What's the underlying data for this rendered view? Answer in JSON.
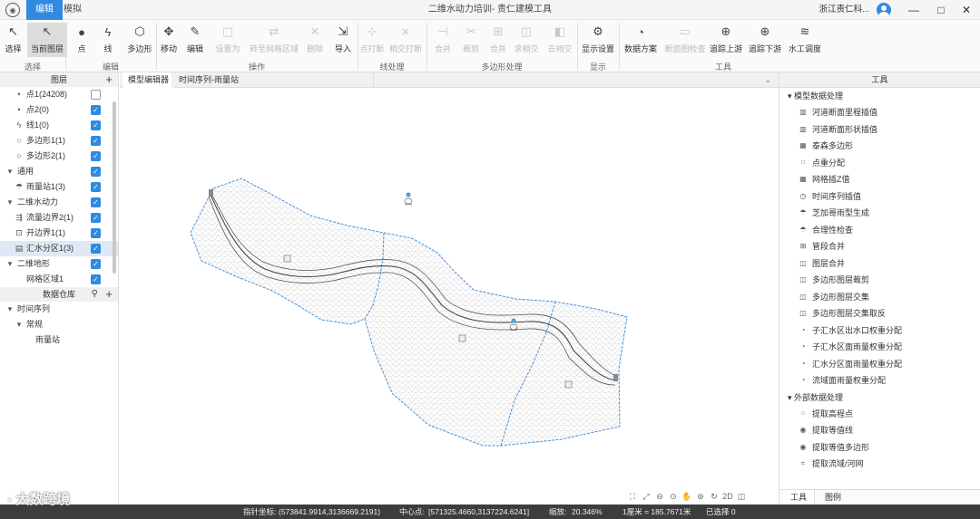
{
  "titlebar": {
    "menu_tabs": [
      "编辑",
      "模拟"
    ],
    "title": "二维水动力培训- 责仁建模工具",
    "user": "浙江责仁科...",
    "controls": [
      "—",
      "□",
      "✕"
    ]
  },
  "toolbar": {
    "buttons": [
      {
        "label": "选择",
        "icon": "↖",
        "enabled": true
      },
      {
        "label": "当前图层",
        "icon": "↖",
        "enabled": true,
        "active": true
      },
      {
        "label": "点",
        "icon": "●",
        "enabled": true
      },
      {
        "label": "线",
        "icon": "ϟ",
        "enabled": true
      },
      {
        "label": "多边形",
        "icon": "⬡",
        "enabled": true
      },
      {
        "label": "移动",
        "icon": "✥",
        "enabled": true
      },
      {
        "label": "编辑",
        "icon": "✎",
        "enabled": true
      },
      {
        "label": "设置为",
        "icon": "▢",
        "enabled": false
      },
      {
        "label": "转至网格区域",
        "icon": "⇄",
        "enabled": false
      },
      {
        "label": "删除",
        "icon": "✕",
        "enabled": false
      },
      {
        "label": "导入",
        "icon": "⇲",
        "enabled": true
      },
      {
        "label": "点打断",
        "icon": "⊹",
        "enabled": false
      },
      {
        "label": "相交打断",
        "icon": "⨯",
        "enabled": false
      },
      {
        "label": "合并",
        "icon": "⊣",
        "enabled": false
      },
      {
        "label": "裁剪",
        "icon": "✂",
        "enabled": false
      },
      {
        "label": "合并",
        "icon": "⊞",
        "enabled": false
      },
      {
        "label": "求相交",
        "icon": "◫",
        "enabled": false
      },
      {
        "label": "去相交",
        "icon": "◧",
        "enabled": false
      },
      {
        "label": "显示设置",
        "icon": "⚙",
        "enabled": true
      },
      {
        "label": "数据方案",
        "icon": "◔",
        "enabled": true
      },
      {
        "label": "断面图检查",
        "icon": "▭",
        "enabled": false
      },
      {
        "label": "追踪上游",
        "icon": "⊕",
        "enabled": true
      },
      {
        "label": "追踪下游",
        "icon": "⊕",
        "enabled": true
      },
      {
        "label": "水工调度",
        "icon": "≋",
        "enabled": true
      }
    ],
    "groups": [
      "选择",
      "编辑",
      "操作",
      "线处理",
      "多边形处理",
      "显示",
      "工具"
    ]
  },
  "layers_panel": {
    "title": "图层",
    "rows": [
      {
        "label": "点1(24208)",
        "icon": "•",
        "indent": 1,
        "checked": false
      },
      {
        "label": "点2(0)",
        "icon": "•",
        "indent": 1,
        "checked": true
      },
      {
        "label": "线1(0)",
        "icon": "ϟ",
        "indent": 1,
        "checked": true
      },
      {
        "label": "多边形1(1)",
        "icon": "○",
        "indent": 1,
        "checked": true
      },
      {
        "label": "多边形2(1)",
        "icon": "○",
        "indent": 1,
        "checked": true
      },
      {
        "label": "通用",
        "icon": "▾",
        "indent": 0,
        "checked": true
      },
      {
        "label": "雨量站1(3)",
        "icon": "☂",
        "indent": 1,
        "checked": true
      },
      {
        "label": "二维水动力",
        "icon": "▾",
        "indent": 0,
        "checked": true
      },
      {
        "label": "流量边界2(1)",
        "icon": "⇶",
        "indent": 1,
        "checked": true
      },
      {
        "label": "开边界1(1)",
        "icon": "⊡",
        "indent": 1,
        "checked": true
      },
      {
        "label": "汇水分区1(3)",
        "icon": "▤",
        "indent": 1,
        "checked": true,
        "selected": true
      },
      {
        "label": "二维地形",
        "icon": "▾",
        "indent": 0,
        "checked": true
      },
      {
        "label": "网格区域1",
        "icon": "",
        "indent": 1,
        "checked": true
      }
    ]
  },
  "warehouse": {
    "title": "数据仓库",
    "rows": [
      {
        "label": "时间序列",
        "icon": "▾",
        "indent": 0
      },
      {
        "label": "常规",
        "icon": "▾",
        "indent": 1
      },
      {
        "label": "雨量站",
        "icon": "",
        "indent": 2
      }
    ]
  },
  "doc_tabs": [
    "模型编辑器",
    "时间序列-雨量站"
  ],
  "doc_dropdown": "⌄",
  "map_tools": [
    "⛶",
    "⤢",
    "⊖",
    "⊙",
    "✋",
    "⊚",
    "↻",
    "2D",
    "◫"
  ],
  "tools_panel": {
    "title": "工具",
    "sections": [
      {
        "title": "模型数据处理",
        "items": [
          {
            "label": "河道断面里程插值",
            "icon": "▥"
          },
          {
            "label": "河道断面形状插值",
            "icon": "▥"
          },
          {
            "label": "泰森多边形",
            "icon": "▦"
          },
          {
            "label": "点重分配",
            "icon": "⁙"
          },
          {
            "label": "网格插Z值",
            "icon": "▦"
          },
          {
            "label": "时间序列插值",
            "icon": "◷"
          },
          {
            "label": "芝加哥雨型生成",
            "icon": "☂"
          },
          {
            "label": "合理性检查",
            "icon": "☂"
          },
          {
            "label": "管段合并",
            "icon": "⊞"
          },
          {
            "label": "图层合并",
            "icon": "◫"
          },
          {
            "label": "多边形图层裁剪",
            "icon": "◫"
          },
          {
            "label": "多边形图层交集",
            "icon": "◫"
          },
          {
            "label": "多边形图层交集取反",
            "icon": "◫"
          },
          {
            "label": "子汇水区出水口权重分配",
            "icon": "◔"
          },
          {
            "label": "子汇水区面雨量权重分配",
            "icon": "◔"
          },
          {
            "label": "汇水分区面雨量权重分配",
            "icon": "◔"
          },
          {
            "label": "流域面雨量权重分配",
            "icon": "◔"
          }
        ]
      },
      {
        "title": "外部数据处理",
        "items": [
          {
            "label": "提取高程点",
            "icon": "⁘"
          },
          {
            "label": "提取等值线",
            "icon": "◉"
          },
          {
            "label": "提取等值多边形",
            "icon": "◉"
          },
          {
            "label": "提取流域/河网",
            "icon": "≈"
          }
        ]
      }
    ],
    "tabs": [
      "工具",
      "图例"
    ]
  },
  "status": {
    "pointer_label": "指针坐标:",
    "pointer_value": "(573841.9914,3136669.2191)",
    "center_label": "中心点:",
    "center_value": "[571325.4660,3137224.6241]",
    "zoom_label": "缩放:",
    "zoom_value": "20.346%",
    "scale_text": "1厘米 = 185.7671米",
    "selected_text": "已选择 0"
  },
  "watermark": "大数跨境",
  "colors": {
    "accent": "#2f8ae0",
    "boundary": "#4a90d9",
    "river": "#444444",
    "mesh": "#c9c9c9",
    "statusbar": "#3d3d3d"
  }
}
